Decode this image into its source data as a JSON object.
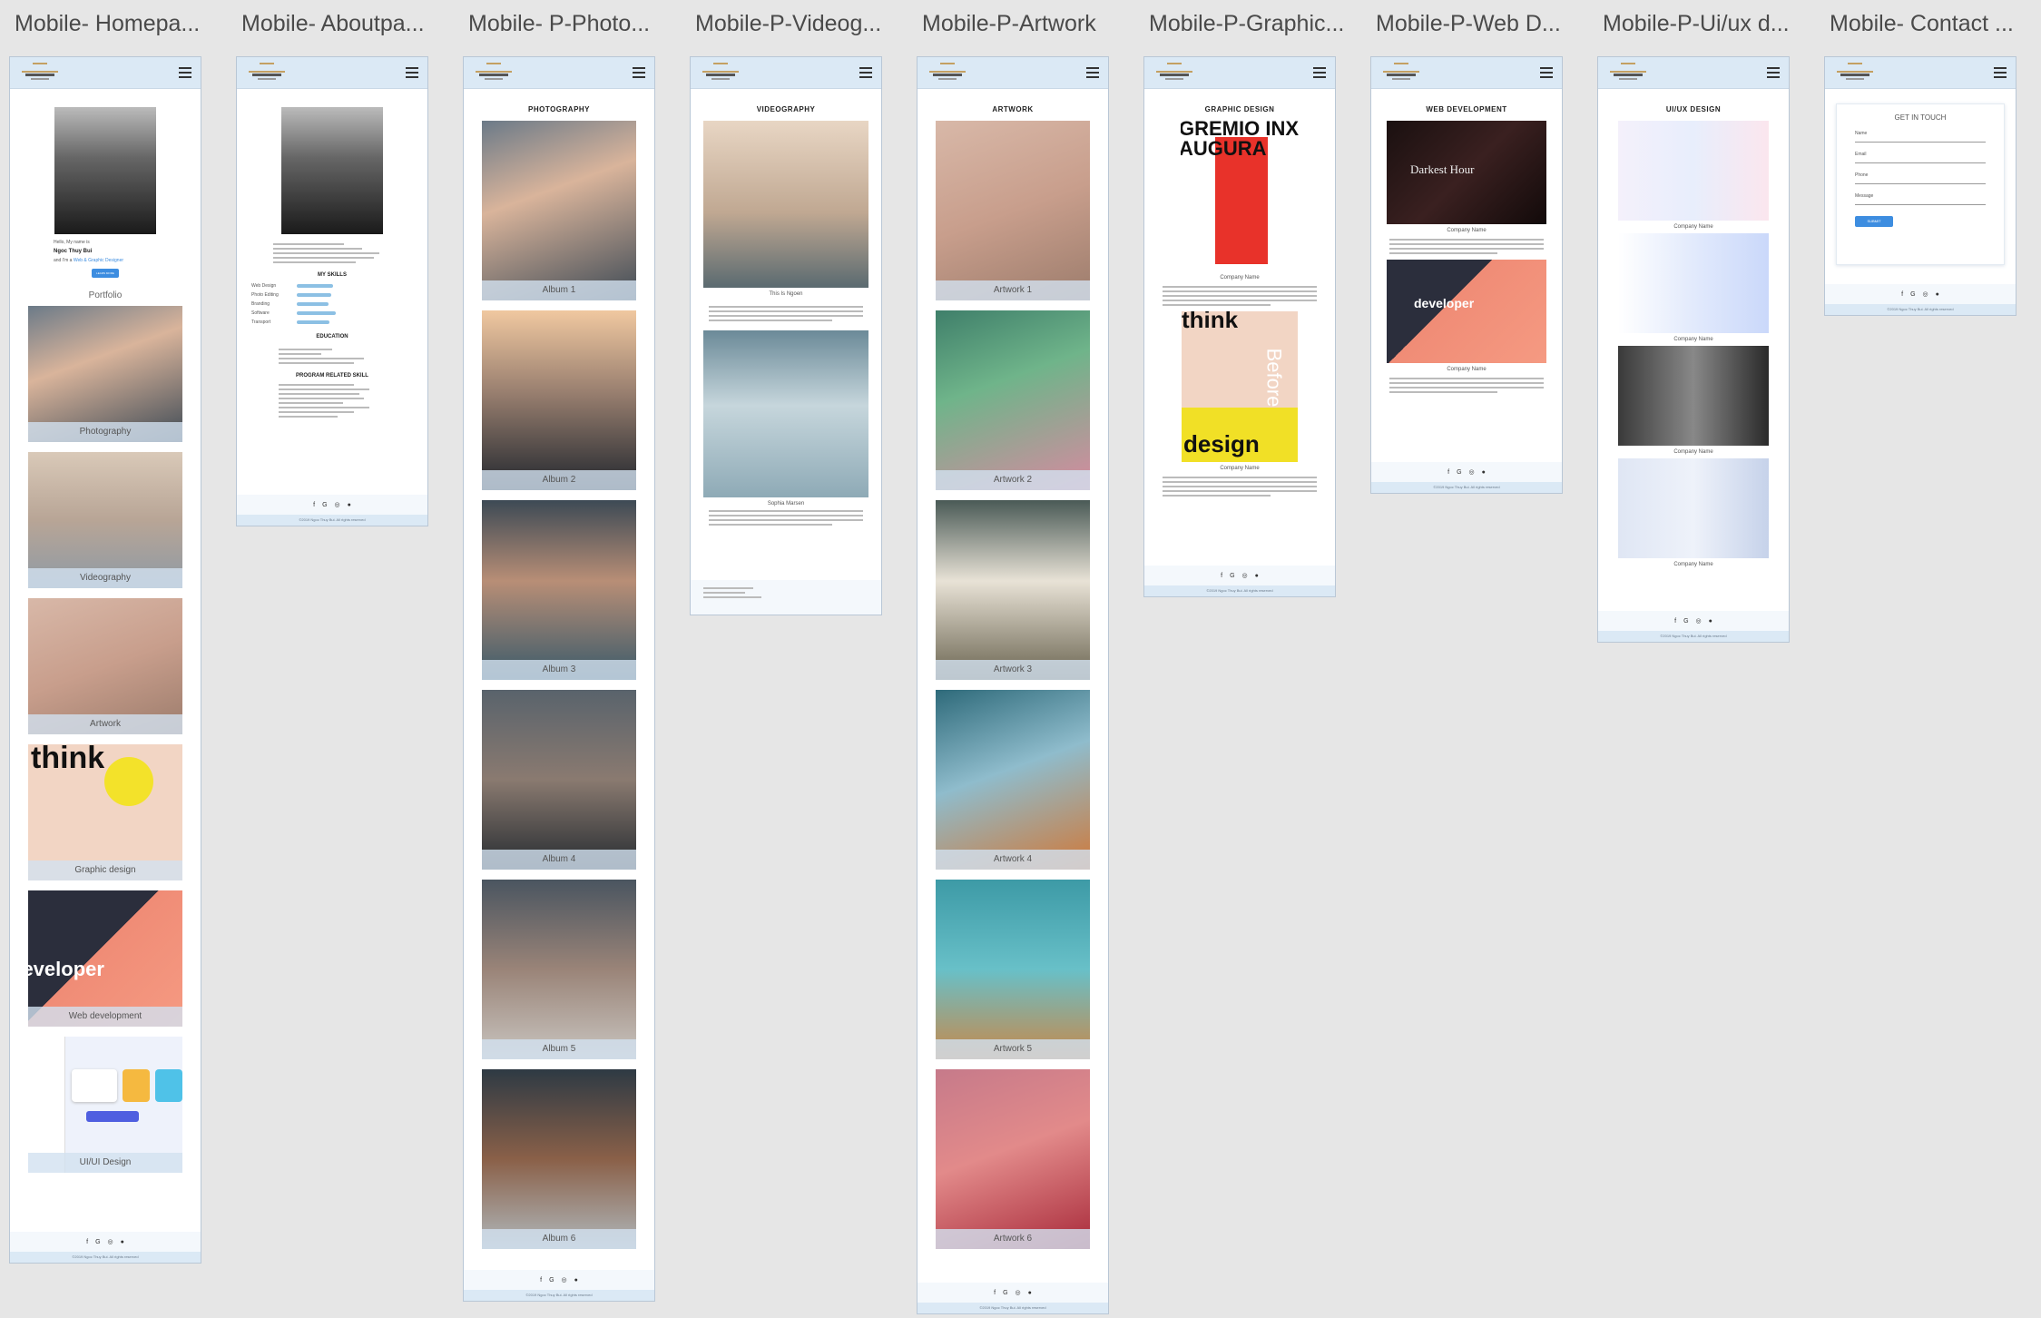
{
  "artboards": [
    {
      "label": "Mobile- Homepa..."
    },
    {
      "label": "Mobile- Aboutpa..."
    },
    {
      "label": "Mobile- P-Photo..."
    },
    {
      "label": "Mobile-P-Videog..."
    },
    {
      "label": "Mobile-P-Artwork"
    },
    {
      "label": "Mobile-P-Graphic..."
    },
    {
      "label": "Mobile-P-Web D..."
    },
    {
      "label": "Mobile-P-Ui/ux d..."
    },
    {
      "label": "Mobile- Contact ..."
    }
  ],
  "home": {
    "greeting": "Hello, My name is",
    "name": "Ngoc Thuy Bui",
    "intro": "and I'm a",
    "role": "Web & Graphic Designer",
    "cta": "LEARN MORE",
    "portfolio_heading": "Portfolio",
    "categories": [
      "Photography",
      "Videography",
      "Artwork",
      "Graphic design",
      "Web development",
      "UI/UI Design"
    ]
  },
  "about": {
    "skills_heading": "MY SKILLS",
    "skills": [
      {
        "name": "Web Design",
        "level": 0.8
      },
      {
        "name": "Photo Editing",
        "level": 0.75
      },
      {
        "name": "Branding",
        "level": 0.7
      },
      {
        "name": "Software",
        "level": 0.85
      },
      {
        "name": "Transport",
        "level": 0.72
      }
    ],
    "education_heading": "EDUCATION",
    "program_heading": "PROGRAM RELATED SKILL"
  },
  "photography": {
    "title": "PHOTOGRAPHY",
    "albums": [
      "Album 1",
      "Album 2",
      "Album 3",
      "Album 4",
      "Album 5",
      "Album 6"
    ]
  },
  "videography": {
    "title": "VIDEOGRAPHY",
    "caption1": "This Is Ngoen",
    "caption2": "Sophia Marsen"
  },
  "artwork": {
    "title": "ARTWORK",
    "items": [
      "Artwork 1",
      "Artwork 2",
      "Artwork 3",
      "Artwork 4",
      "Artwork 5",
      "Artwork 6"
    ]
  },
  "graphic": {
    "title": "GRAPHIC DESIGN",
    "company": "Company Name",
    "poster_text": "GREMIO INX AUGURA",
    "think": "think",
    "design": "design",
    "before": "Before"
  },
  "webdev": {
    "title": "WEB DEVELOPMENT",
    "company": "Company Name",
    "movie": "Darkest Hour",
    "developer": "developer"
  },
  "uiux": {
    "title": "UI/UX DESIGN",
    "company": "Company Name"
  },
  "contact": {
    "title": "GET IN TOUCH",
    "fields": [
      "Name",
      "Email",
      "Phone",
      "Message"
    ],
    "submit": "SUBMIT"
  },
  "footer": {
    "icons": [
      "facebook-icon",
      "google-icon",
      "instagram-icon",
      "github-icon"
    ],
    "copyright": "©2019 Ngoc Thuy Bui. All rights reserved"
  }
}
